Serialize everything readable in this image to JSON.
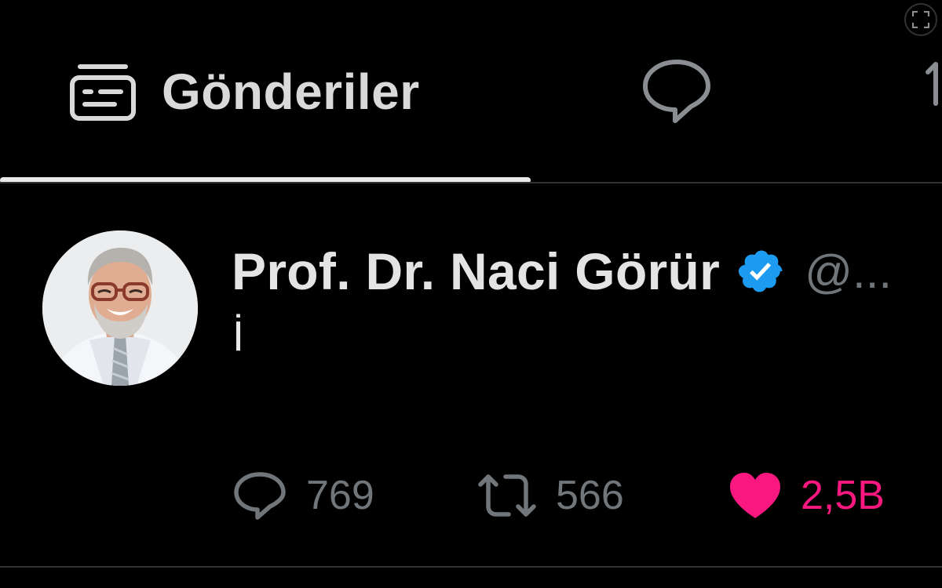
{
  "tabs": [
    {
      "label": "Gönderiler",
      "icon": "posts-card-icon",
      "active": true
    },
    {
      "label": "",
      "icon": "replies-speech-bubble-icon",
      "active": false
    },
    {
      "label": "",
      "icon": "partial-tab-icon",
      "active": false
    }
  ],
  "post": {
    "display_name": "Prof. Dr. Naci Görür",
    "verified": true,
    "handle": "@...",
    "text": "İ",
    "actions": {
      "replies": "769",
      "reposts": "566",
      "likes": "2,5B",
      "liked": true
    }
  },
  "colors": {
    "background": "#000000",
    "verified_badge": "#1d9bf0",
    "like_active": "#f91880",
    "muted_text": "#71767b",
    "divider": "#2f3336"
  }
}
